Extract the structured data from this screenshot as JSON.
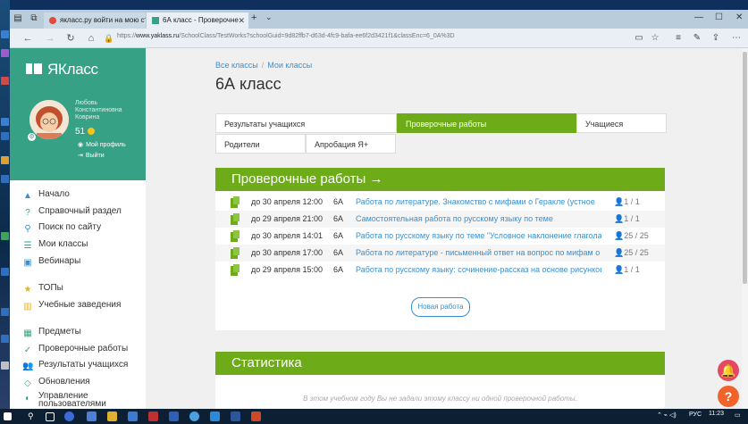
{
  "browser": {
    "tabs": [
      {
        "title": "якласс.ру войти на мою ст",
        "active": false
      },
      {
        "title": "6А класс - Проверочне",
        "active": true
      }
    ],
    "url_prefix": "https://",
    "url_domain": "www.yaklass.ru",
    "url_path": "/SchoolClass/TestWorks?schoolGuid=9d82ffb7-d63d-4fc9-bafa-ee6f2d3421f1&classEnc=6_0A%3D"
  },
  "sidebar": {
    "logo": "ЯКласс",
    "user_name": "Любовь Константиновна Коврина",
    "points": "51",
    "profile_link": "Мой профиль",
    "logout_link": "Выйти",
    "items": [
      {
        "label": "Начало",
        "icon": "home-icon"
      },
      {
        "label": "Справочный раздел",
        "icon": "help-circle-icon"
      },
      {
        "label": "Поиск по сайту",
        "icon": "search-icon"
      },
      {
        "label": "Мои классы",
        "icon": "classes-icon"
      },
      {
        "label": "Вебинары",
        "icon": "webinar-icon"
      },
      {
        "label": "ТОПы",
        "icon": "star-icon"
      },
      {
        "label": "Учебные заведения",
        "icon": "school-icon"
      },
      {
        "label": "Предметы",
        "icon": "subjects-icon"
      },
      {
        "label": "Проверочные работы",
        "icon": "check-circle-icon"
      },
      {
        "label": "Результаты учащихся",
        "icon": "users-icon"
      },
      {
        "label": "Обновления",
        "icon": "updates-icon"
      },
      {
        "label": "Управление пользователями",
        "icon": "manage-users-icon"
      }
    ]
  },
  "main": {
    "breadcrumb": [
      "Все классы",
      "Мои классы"
    ],
    "title": "6А класс",
    "tabs": [
      {
        "label": "Результаты учащихся",
        "active": false
      },
      {
        "label": "Проверочные работы",
        "active": true
      },
      {
        "label": "Учащиеся",
        "active": false
      },
      {
        "label": "Родители",
        "active": false
      },
      {
        "label": "Апробация Я+",
        "active": false
      }
    ],
    "works_header": "Проверочные работы →",
    "works": [
      {
        "date": "до 30 апреля 12:00",
        "class": "6А",
        "title": "Работа по литературе. Знакомство с мифами о Геракле (устное",
        "count": "1 / 1"
      },
      {
        "date": "до 29 апреля 21:00",
        "class": "6А",
        "title": "Самостоятельная работа по русскому языку по теме",
        "count": "1 / 1"
      },
      {
        "date": "до 30 апреля 14:01",
        "class": "6А",
        "title": "Работа по русскому языку по теме \"Условное наклонение глагола\"",
        "count": "25 / 25"
      },
      {
        "date": "до 30 апреля 17:00",
        "class": "6А",
        "title": "Работа по литературе - письменный ответ на вопрос по мифам о",
        "count": "25 / 25"
      },
      {
        "date": "до 29 апреля 15:00",
        "class": "6А",
        "title": "Работа по русскому языку: сочинение-рассказ на основе рисунков",
        "count": "1 / 1"
      }
    ],
    "new_work_button": "Новая работа",
    "stats_header": "Статистика",
    "stats_empty": "В этом учебном году Вы не задали этому классу ни одной проверочной работы."
  },
  "taskbar": {
    "lang": "РУС",
    "time": "11:23"
  },
  "colors": {
    "sidebar_green": "#37a185",
    "accent_green": "#6dab19",
    "link_blue": "#3a8fd0"
  }
}
